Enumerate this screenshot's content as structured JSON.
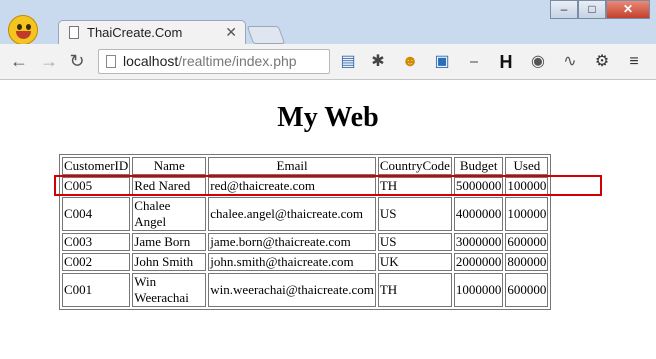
{
  "browser": {
    "tab_title": "ThaiCreate.Com",
    "url_host": "localhost",
    "url_path": "/realtime/index.php"
  },
  "page": {
    "heading": "My Web"
  },
  "table": {
    "headers": [
      "CustomerID",
      "Name",
      "Email",
      "CountryCode",
      "Budget",
      "Used"
    ],
    "rows": [
      [
        "C005",
        "Red Nared",
        "red@thaicreate.com",
        "TH",
        "5000000",
        "100000"
      ],
      [
        "C004",
        "Chalee Angel",
        "chalee.angel@thaicreate.com",
        "US",
        "4000000",
        "100000"
      ],
      [
        "C003",
        "Jame Born",
        "jame.born@thaicreate.com",
        "US",
        "3000000",
        "600000"
      ],
      [
        "C002",
        "John Smith",
        "john.smith@thaicreate.com",
        "UK",
        "2000000",
        "800000"
      ],
      [
        "C001",
        "Win Weerachai",
        "win.weerachai@thaicreate.com",
        "TH",
        "1000000",
        "600000"
      ]
    ]
  },
  "colors": {
    "highlight": "#d40000"
  }
}
